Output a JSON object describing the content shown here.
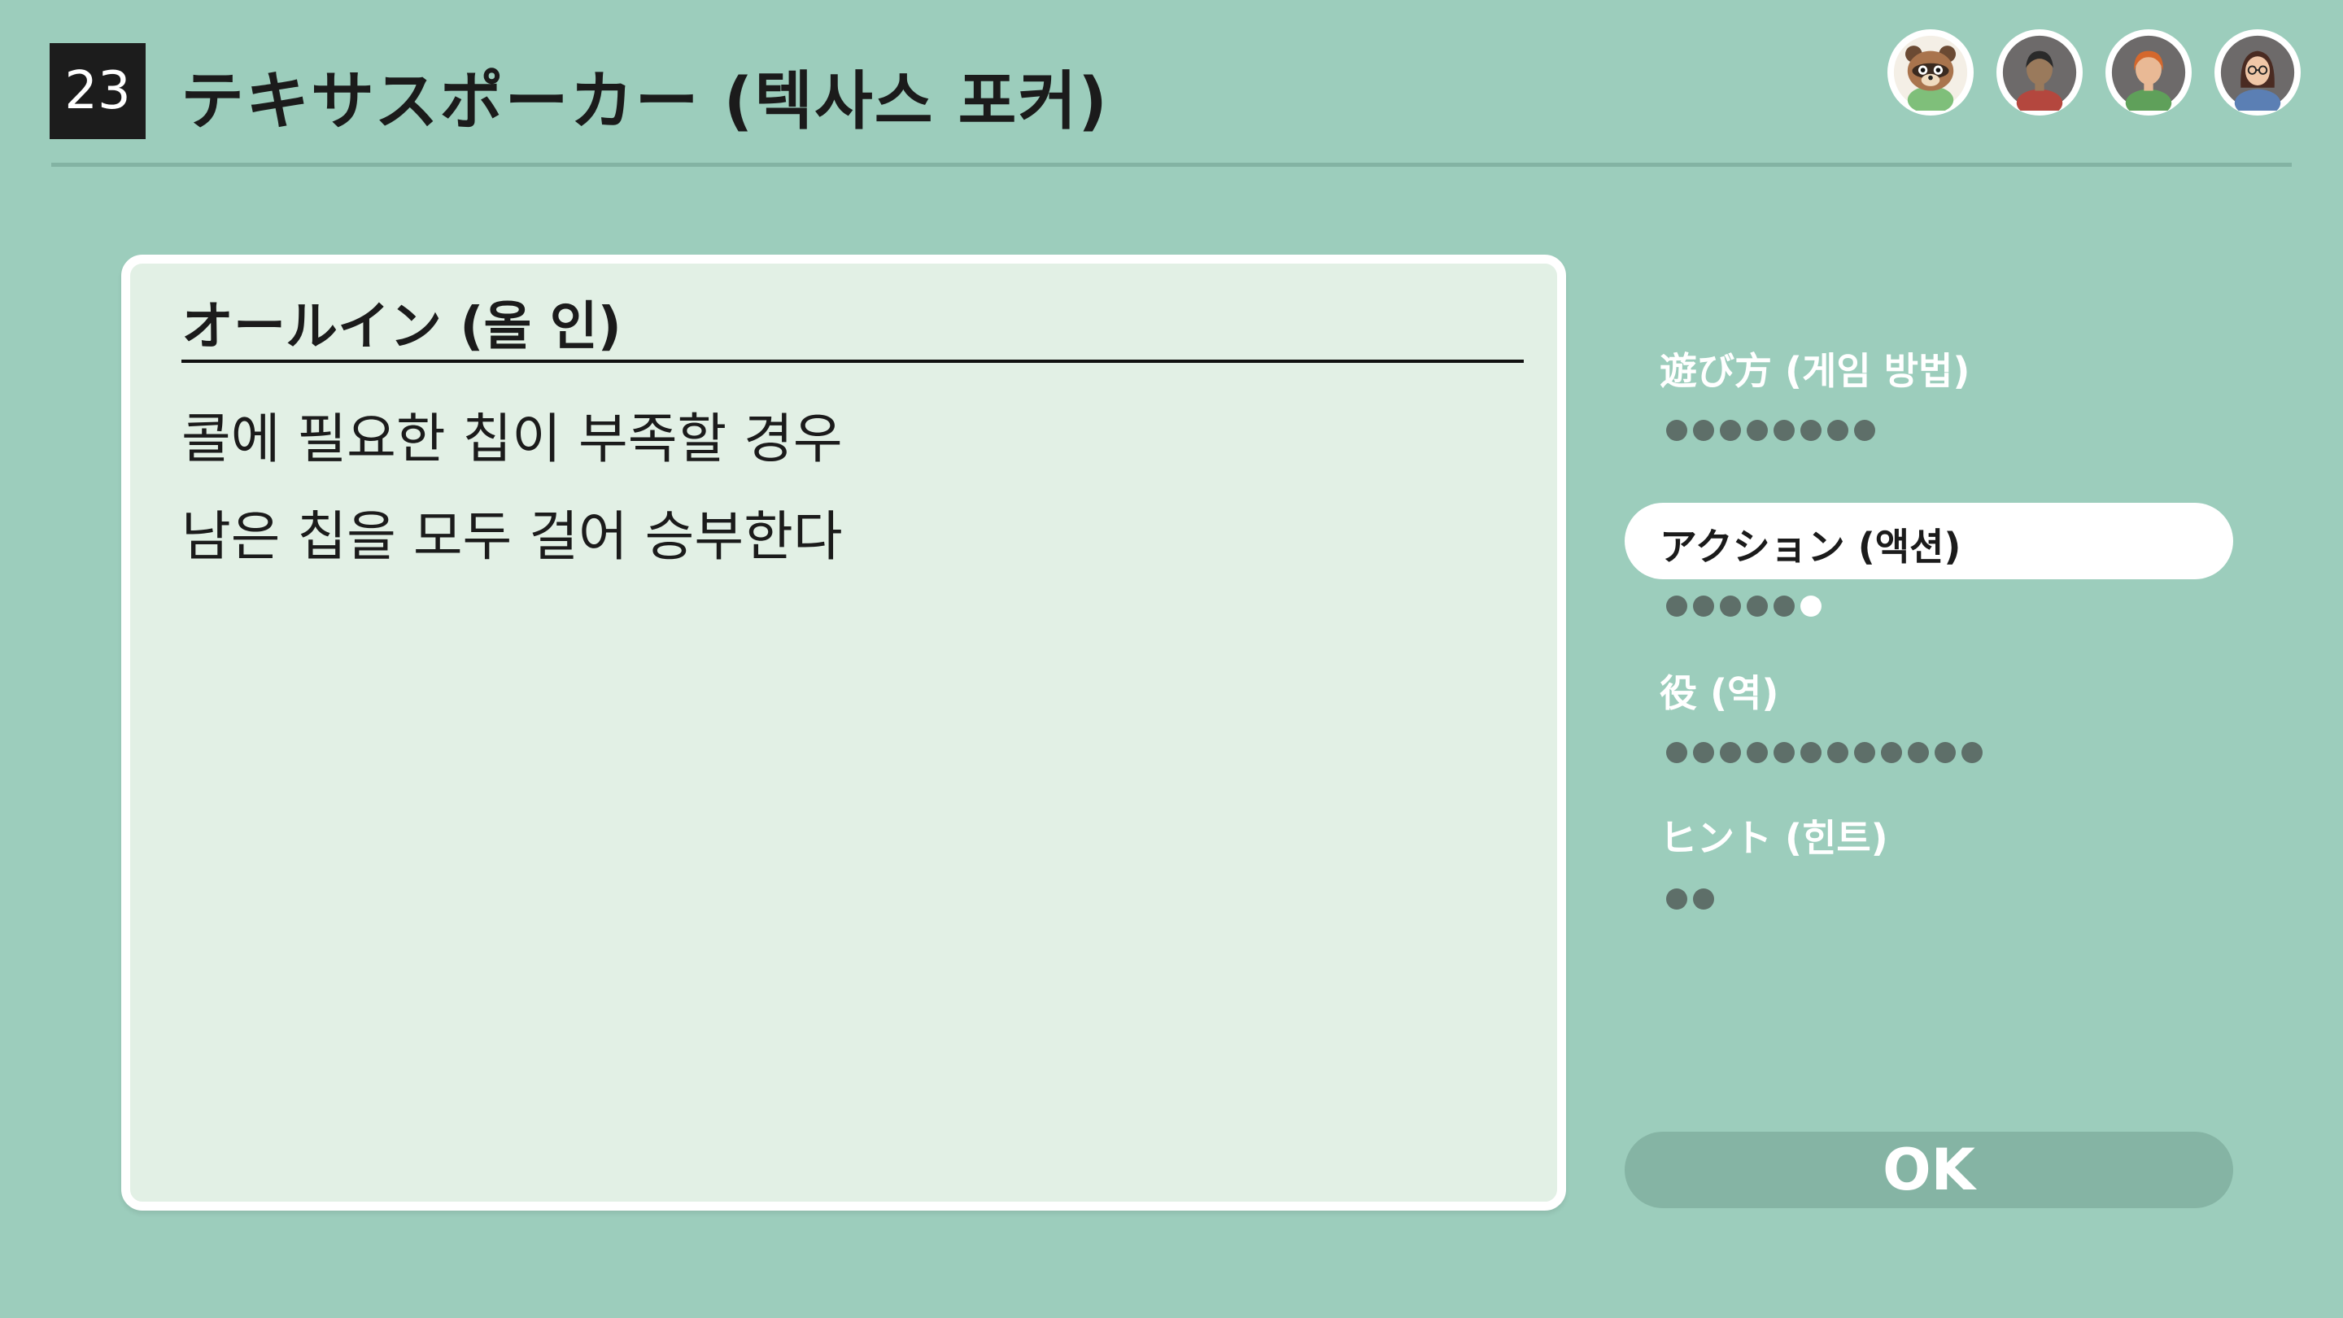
{
  "header": {
    "number": "23",
    "title": "テキサスポーカー (텍사스 포커)"
  },
  "avatars": [
    {
      "icon": "raccoon-character-icon"
    },
    {
      "icon": "player-avatar-dark-hair-icon"
    },
    {
      "icon": "player-avatar-orange-hair-icon"
    },
    {
      "icon": "player-avatar-glasses-icon"
    }
  ],
  "panel": {
    "heading": "オールイン (올 인)",
    "lines": [
      "콜에 필요한 칩이 부족할 경우",
      "남은 칩을 모두 걸어 승부한다"
    ]
  },
  "menu": {
    "items": [
      {
        "label": "遊び方 (게임 방법)",
        "pages": 8,
        "current": null
      },
      {
        "label": "アクション (액션)",
        "pages": 6,
        "current": 6,
        "selected": true
      },
      {
        "label": "役 (역)",
        "pages": 12,
        "current": null
      },
      {
        "label": "ヒント (힌트)",
        "pages": 2,
        "current": null
      }
    ]
  },
  "ok_button": {
    "label": "OK"
  },
  "colors": {
    "background": "#9ccdbc",
    "panel": "#e2f0e5",
    "dot": "#5e6f69",
    "ok_button": "#85b4a4"
  }
}
